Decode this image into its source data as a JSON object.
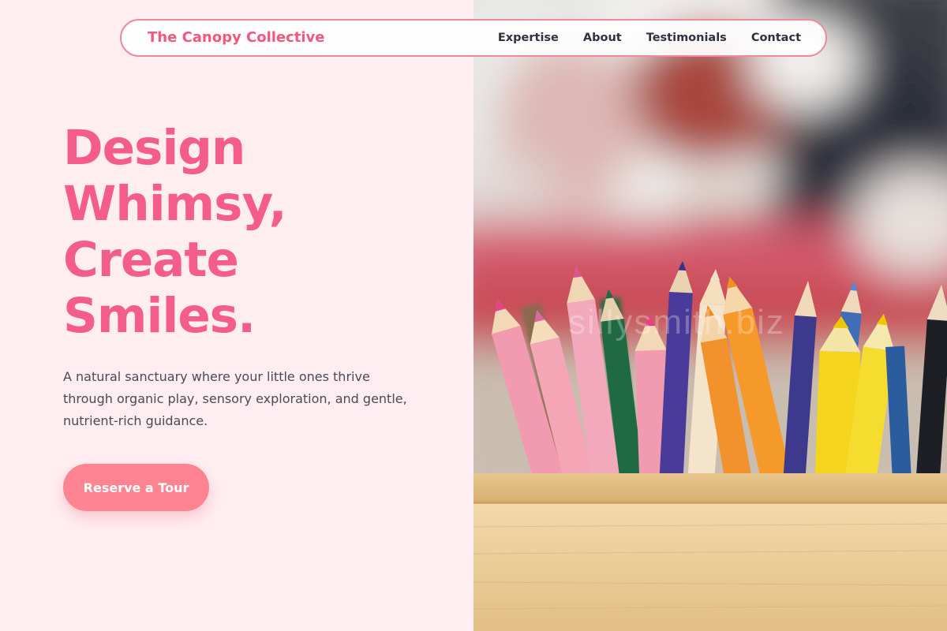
{
  "nav": {
    "brand": "The Canopy Collective",
    "links": [
      {
        "label": "Expertise"
      },
      {
        "label": "About"
      },
      {
        "label": "Testimonials"
      },
      {
        "label": "Contact"
      }
    ]
  },
  "hero": {
    "headline_lines": [
      "Design",
      "Whimsy,",
      "Create",
      "Smiles."
    ],
    "subtext": "A natural sanctuary where your little ones thrive through organic play, sensory exploration, and gentle, nutrient-rich guidance.",
    "cta_label": "Reserve a Tour",
    "image_watermark": "sillysmith.biz"
  },
  "colors": {
    "accent": "#f45c89",
    "page_background": "#ffeef1",
    "button": "#fe8492",
    "nav_border": "#f08a9a",
    "nav_text": "#2f3140",
    "body_text": "#4a4a57"
  }
}
